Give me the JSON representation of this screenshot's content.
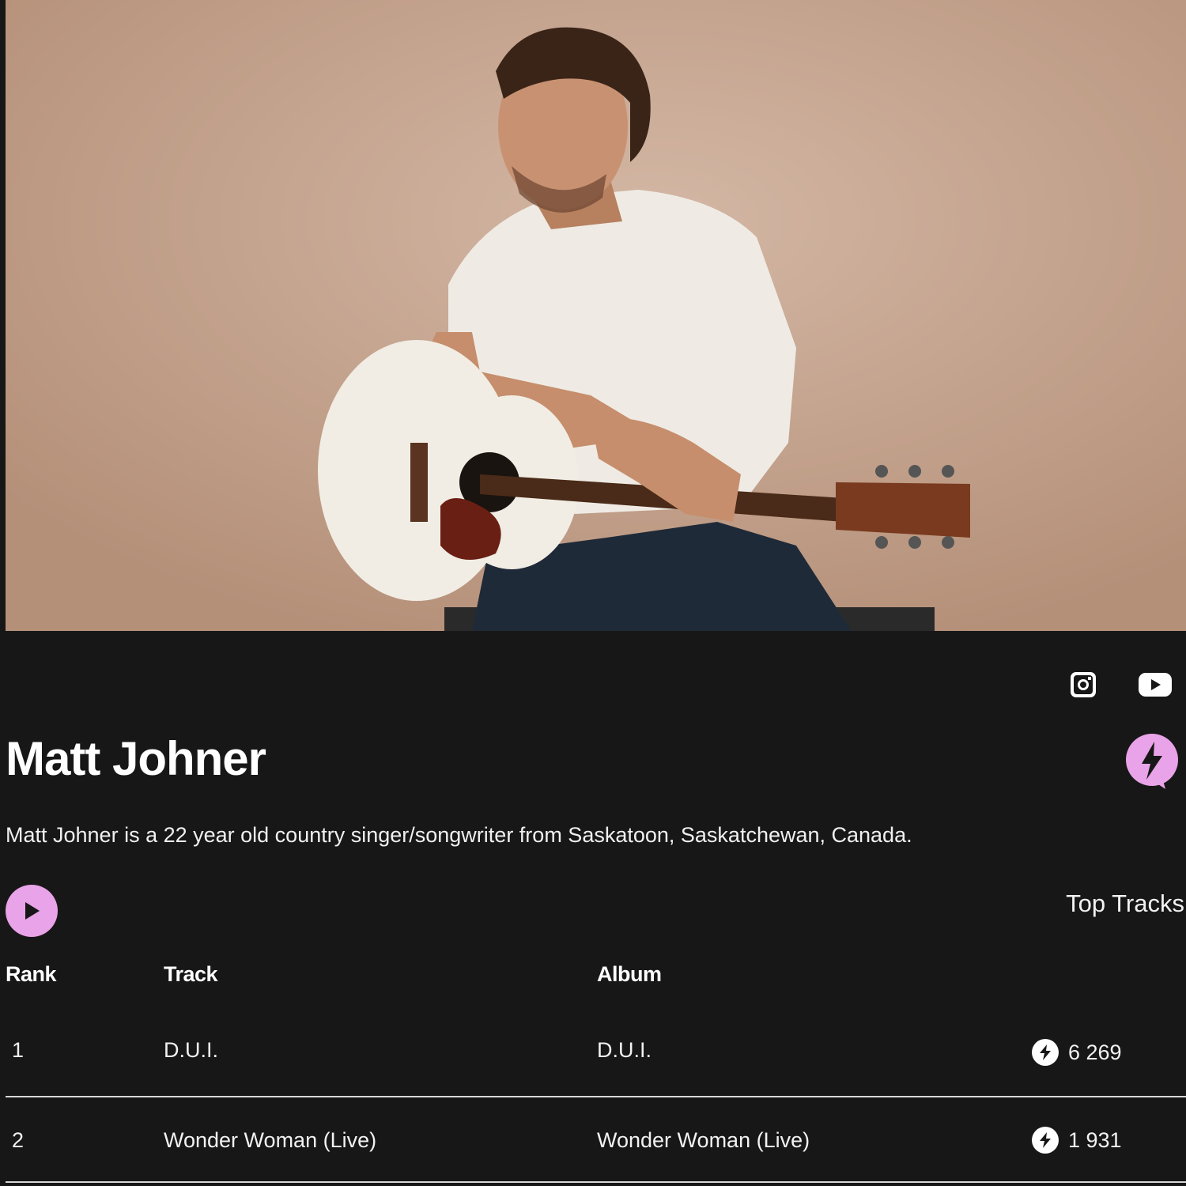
{
  "artist": {
    "name": "Matt Johner",
    "bio": "Matt Johner is a 22 year old country singer/songwriter from Saskatoon, Saskatchewan, Canada."
  },
  "social": [
    "instagram-icon",
    "youtube-icon"
  ],
  "tracks_section": {
    "title": "Top Tracks",
    "headers": {
      "rank": "Rank",
      "track": "Track",
      "album": "Album"
    },
    "rows": [
      {
        "rank": "1",
        "track": "D.U.I.",
        "album": "D.U.I.",
        "count": "6 269"
      },
      {
        "rank": "2",
        "track": "Wonder Woman (Live)",
        "album": "Wonder Woman (Live)",
        "count": "1 931"
      }
    ]
  },
  "colors": {
    "background": "#171717",
    "accent": "#e9a3e8",
    "text": "#ffffff"
  }
}
